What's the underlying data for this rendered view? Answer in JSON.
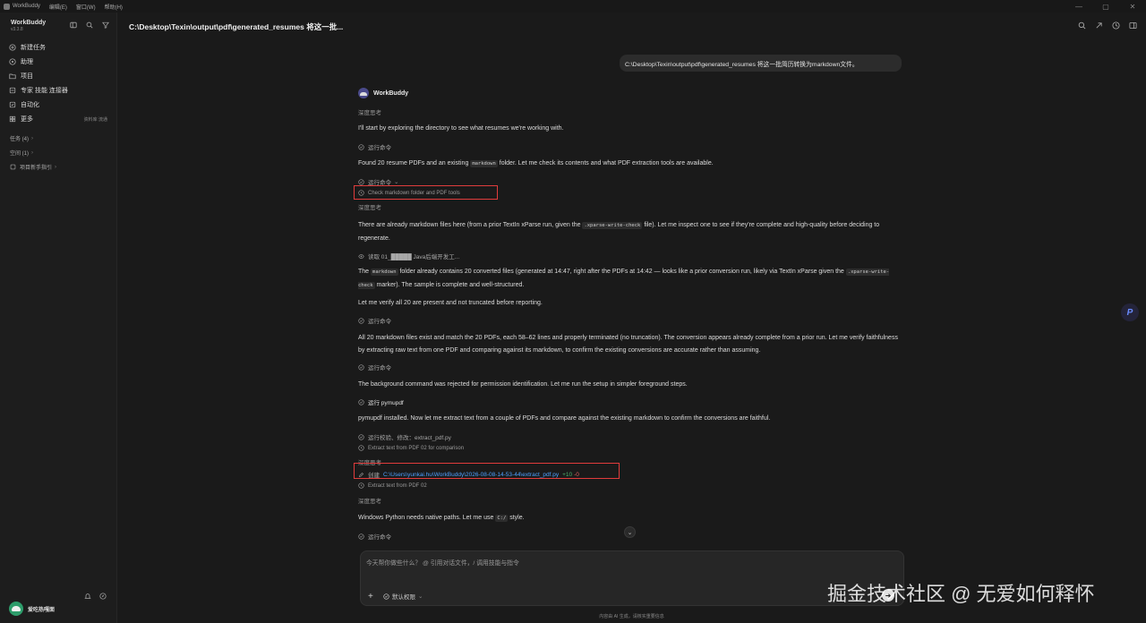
{
  "menubar": {
    "app_name": "WorkBuddy",
    "items": [
      "编辑(E)",
      "窗口(W)",
      "帮助(H)"
    ],
    "controls": [
      "—",
      "▢",
      "✕"
    ]
  },
  "sidebar": {
    "brand": "WorkBuddy",
    "version": "v3.3.8",
    "nav": [
      {
        "label": "新建任务",
        "icon": "new-task-icon"
      },
      {
        "label": "助理",
        "icon": "assistant-icon"
      },
      {
        "label": "项目",
        "icon": "project-icon"
      },
      {
        "label": "专家 技能 连接器",
        "icon": "expert-icon"
      },
      {
        "label": "自动化",
        "icon": "automation-icon"
      },
      {
        "label": "更多",
        "icon": "more-icon",
        "extra": "资料库 流通"
      }
    ],
    "groups": [
      {
        "label": "任务 (4)"
      },
      {
        "label": "空间 (1)"
      },
      {
        "label": "项目新手指引"
      }
    ],
    "user_name": "爱吃热嘎面"
  },
  "main": {
    "title": "C:\\Desktop\\Texin\\output\\pdf\\generated_resumes 将这一批...",
    "user_message": "C:\\Desktop\\Texin\\output\\pdf\\generated_resumes  将这一批简历转换为markdown文件。",
    "bot_name": "WorkBuddy",
    "think1": "深度思考",
    "p1": "I'll start by exploring the directory to see what resumes we're working with.",
    "step1": "运行命令",
    "p2a": "Found 20 resume PDFs and an existing",
    "p2code": "markdown",
    "p2b": "folder. Let me check its contents and what PDF extraction tools are available.",
    "step2": "运行命令",
    "step2_sub": "Check markdown folder and PDF tools",
    "think2": "深度思考",
    "p3a": "There are already markdown files here (from a prior TextIn xParse run, given the",
    "p3code": ".xparse-write-check",
    "p3b": "file). Let me inspect one to see if they're complete and high-quality before deciding to regenerate.",
    "step3": "读取 01_█████ Java后端开发工...",
    "p4a": "The",
    "p4code1": "markdown",
    "p4b": "folder already contains 20 converted files (generated at 14:47, right after the PDFs at 14:42 — looks like a prior conversion run, likely via TextIn xParse given the",
    "p4code2": ".xparse-write-check",
    "p4c": "marker). The sample is complete and well-structured.",
    "p5": "Let me verify all 20 are present and not truncated before reporting.",
    "step4": "运行命令",
    "p6": "All 20 markdown files exist and match the 20 PDFs, each 58–62 lines and properly terminated (no truncation). The conversion appears already complete from a prior run. Let me verify faithfulness by extracting raw text from one PDF and comparing against its markdown, to confirm the existing conversions are accurate rather than assuming.",
    "step5": "运行命令",
    "p7": "The background command was rejected for permission identification. Let me run the setup in simpler foreground steps.",
    "step6": "运行 pymupdf",
    "p8": "pymupdf installed. Now let me extract text from a couple of PDFs and compare against the existing markdown to confirm the conversions are faithful.",
    "step7": "运行校验、修改：extract_pdf.py",
    "step7_sub": "Extract text from PDF 02 for comparison",
    "think3": "深度思考",
    "step8_label": "创建",
    "step8_path": "C:\\Users\\yunkai.hu\\WorkBuddy\\2026-08-08-14-53-44\\extract_pdf.py",
    "step8_add": "+10",
    "step8_del": "-0",
    "step8_sub": "Extract text from PDF 02",
    "think4": "深度思考",
    "p9a": "Windows Python needs native paths. Let me use",
    "p9code": "C:/",
    "p9b": "style.",
    "step9": "运行命令"
  },
  "composer": {
    "placeholder": "今天帮你做些什么？ @ 引用对话文件，/ 调用技能与指令",
    "plus": "+",
    "permission": "默认权限",
    "send": "➜"
  },
  "disclaimer": "内容由 AI 生成，请核实重要信息",
  "float_button": "P",
  "watermark": "掘金技术社区 @ 无爱如何释怀",
  "colors": {
    "accent_link": "#4da0ff",
    "highlight_box": "#e03c3c",
    "add": "#4caf6a",
    "del": "#e06060"
  }
}
